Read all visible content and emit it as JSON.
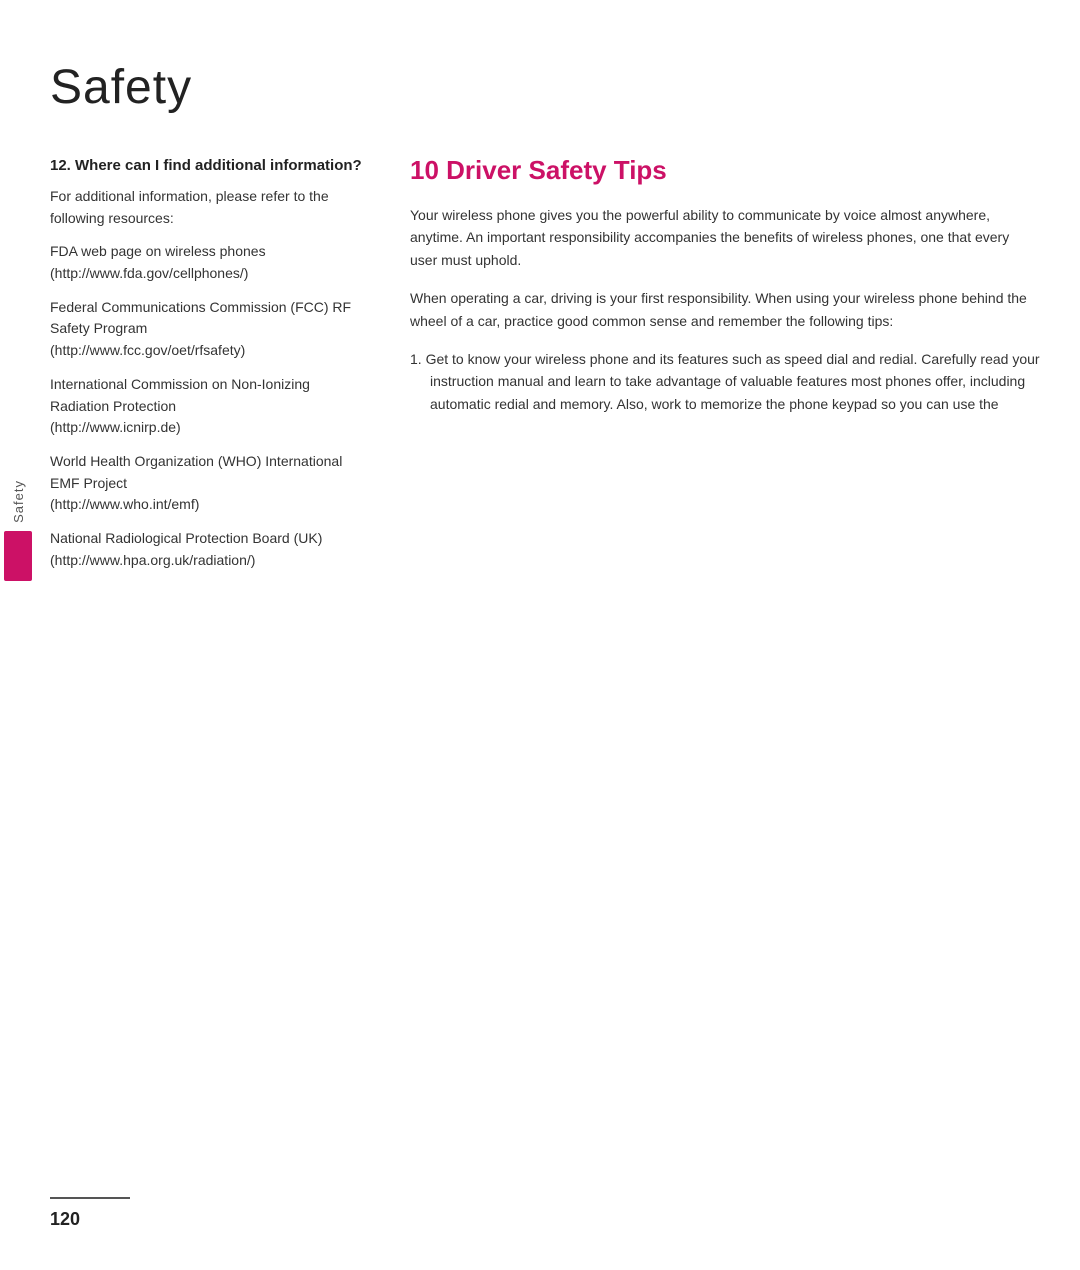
{
  "page": {
    "title": "Safety",
    "page_number": "120"
  },
  "side_tab": {
    "label": "Safety"
  },
  "left_column": {
    "section_heading": "12. Where can I find additional information?",
    "intro_text": "For additional information, please refer to the following resources:",
    "resources": [
      {
        "name": "FDA web page on wireless phones",
        "url": "(http://www.fda.gov/cellphones/)"
      },
      {
        "name": "Federal Communications Commission (FCC) RF Safety Program",
        "url": "(http://www.fcc.gov/oet/rfsafety)"
      },
      {
        "name": "International Commission on Non-Ionizing Radiation Protection",
        "url": "(http://www.icnirp.de)"
      },
      {
        "name": "World Health Organization (WHO) International EMF Project",
        "url": "(http://www.who.int/emf)"
      },
      {
        "name": "National Radiological Protection Board (UK)",
        "url": "(http://www.hpa.org.uk/radiation/)"
      }
    ]
  },
  "right_column": {
    "heading": "10 Driver Safety Tips",
    "paragraphs": [
      "Your wireless phone gives you the powerful ability to communicate by voice almost anywhere, anytime. An important responsibility accompanies the benefits of wireless phones, one that every user must uphold.",
      "When operating a car, driving is your first responsibility. When using your wireless phone behind the wheel of a car, practice good common sense and remember the following tips:"
    ],
    "list_items": [
      "1. Get to know your wireless phone and its features such as speed dial and redial. Carefully read your instruction manual and learn to take advantage of valuable features most phones offer, including automatic redial and memory. Also, work to memorize the phone keypad so you can use the"
    ]
  },
  "colors": {
    "accent": "#cc1166",
    "text_primary": "#222222",
    "text_body": "#333333"
  }
}
